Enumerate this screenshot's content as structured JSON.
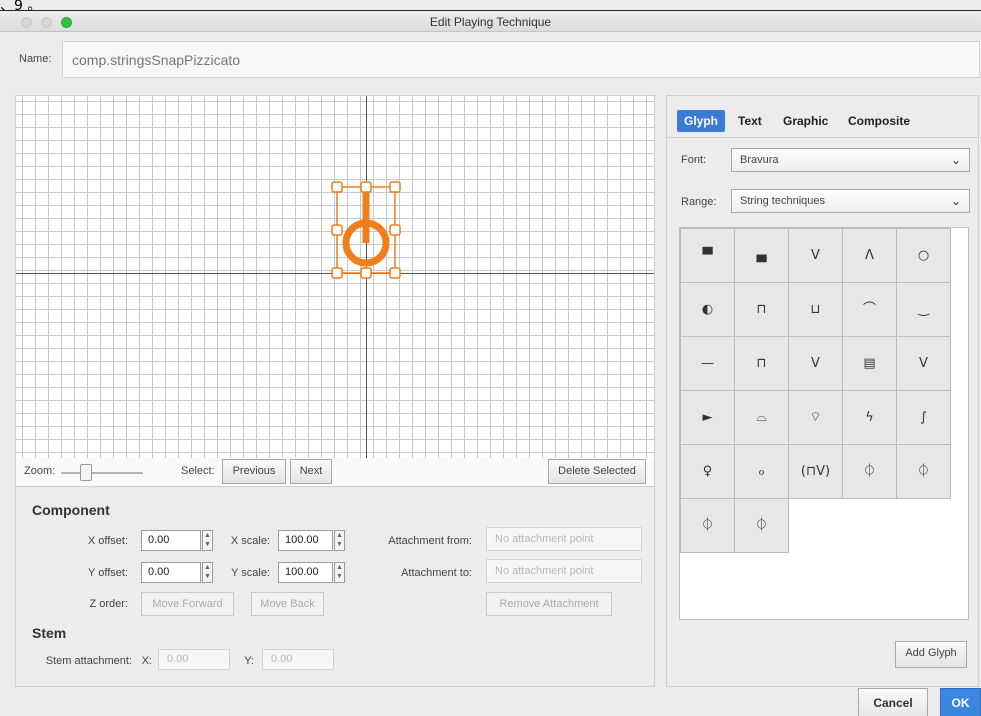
{
  "artifact_text": "、9 。",
  "window": {
    "title": "Edit Playing Technique"
  },
  "name": {
    "label": "Name:",
    "value": "comp.stringsSnapPizzicato"
  },
  "editor": {
    "zoom_label": "Zoom:",
    "zoom_level": 0.25,
    "select_label": "Select:",
    "previous_label": "Previous",
    "next_label": "Next",
    "delete_label": "Delete Selected",
    "glyph_color": "#f07e1b"
  },
  "component": {
    "title": "Component",
    "x_offset_label": "X offset:",
    "x_offset_value": "0.00",
    "y_offset_label": "Y offset:",
    "y_offset_value": "0.00",
    "x_scale_label": "X scale:",
    "x_scale_value": "100.00",
    "y_scale_label": "Y scale:",
    "y_scale_value": "100.00",
    "z_order_label": "Z order:",
    "move_forward_label": "Move Forward",
    "move_back_label": "Move Back",
    "attach_from_label": "Attachment from:",
    "attach_from_value": "No attachment point",
    "attach_to_label": "Attachment to:",
    "attach_to_value": "No attachment point",
    "remove_attachment_label": "Remove Attachment"
  },
  "stem": {
    "title": "Stem",
    "attachment_label": "Stem attachment:",
    "x_label": "X:",
    "x_value": "0.00",
    "y_label": "Y:",
    "y_value": "0.00"
  },
  "glyph_panel": {
    "tabs": [
      "Glyph",
      "Text",
      "Graphic",
      "Composite"
    ],
    "active_tab": "Glyph",
    "font_label": "Font:",
    "font_value": "Bravura",
    "range_label": "Range:",
    "range_value": "String techniques",
    "glyphs": [
      "▀",
      "▄",
      "V",
      "Λ",
      "○",
      "◐",
      "⊓",
      "⊔",
      "⌒",
      "‿",
      "—",
      "⊓",
      "V",
      "▤",
      "V",
      "►",
      "⌓",
      "⌔",
      "ϟ",
      "∫",
      "♀",
      "ℴ",
      "(⊓V)",
      "⏀",
      "⏀",
      "⏀",
      "⏀"
    ],
    "add_glyph_label": "Add Glyph",
    "accent_color": "#3a7bd5"
  },
  "footer": {
    "cancel_label": "Cancel",
    "ok_label": "OK"
  }
}
